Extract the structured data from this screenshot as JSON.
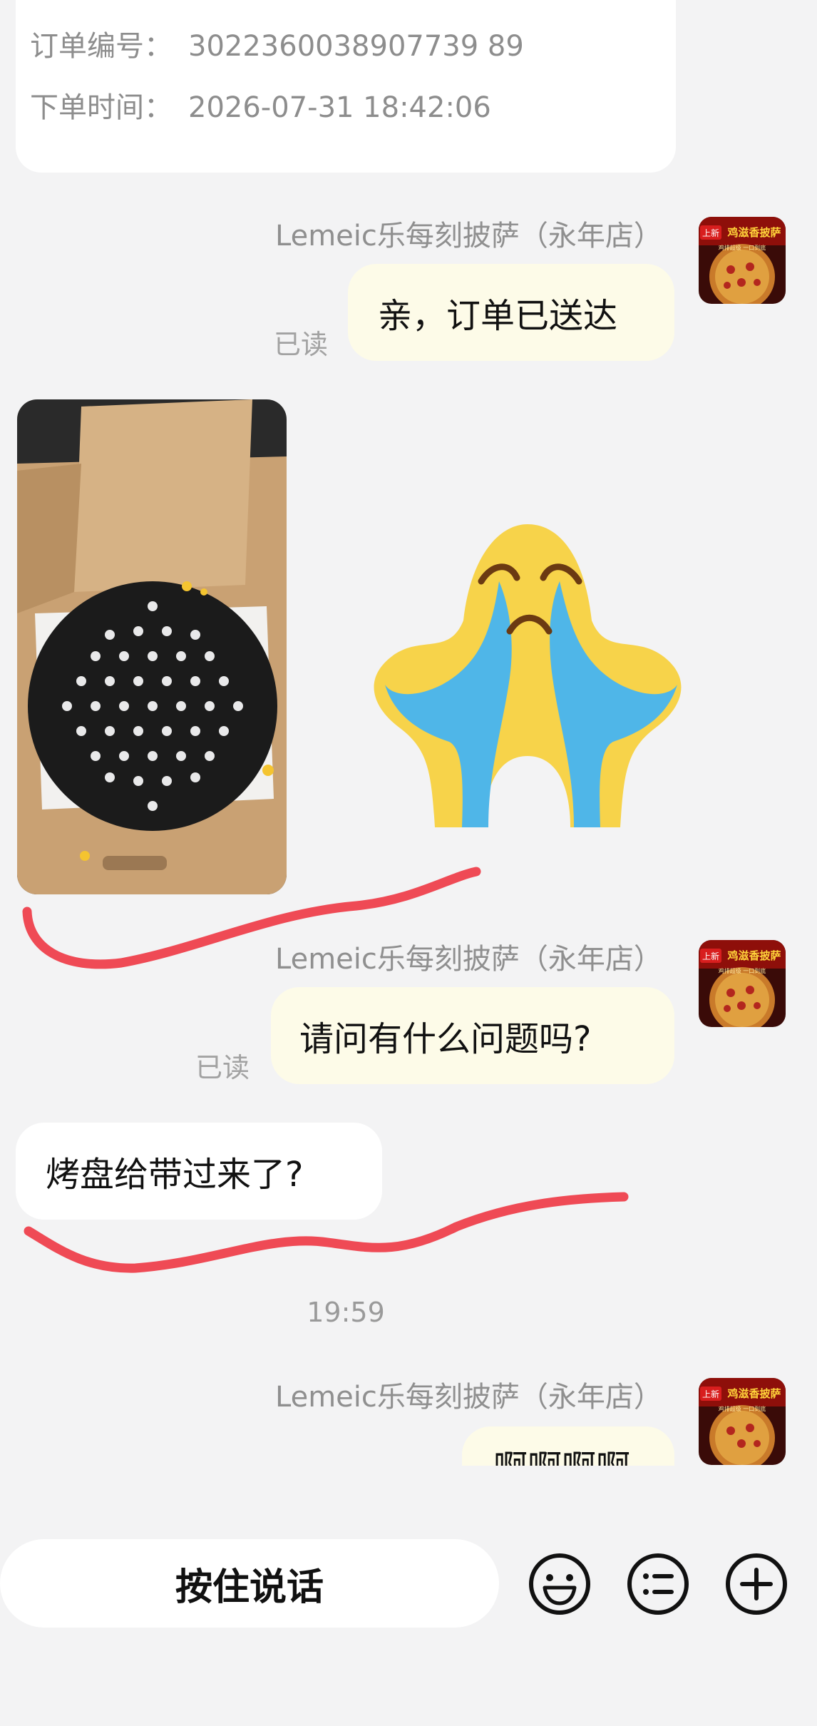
{
  "order": {
    "number_label": "订单编号：",
    "number_value": "3022360038907739 89",
    "time_label": "下单时间：",
    "time_value": "2026-07-31 18:42:06"
  },
  "messages": {
    "m1": {
      "sender": "Lemeic乐每刻披萨（永年店）",
      "text": "亲，订单已送达",
      "read": "已读"
    },
    "m2": {
      "sender": "Lemeic乐每刻披萨（永年店）",
      "text": "请问有什么问题吗?",
      "read": "已读"
    },
    "m3": {
      "text": "烤盘给带过来了?"
    },
    "time_divider": "19:59",
    "m4": {
      "sender": "Lemeic乐每刻披萨（永年店）",
      "text": "啊啊啊啊"
    }
  },
  "avatar": {
    "badge": "上新",
    "title": "鸡滋香披萨",
    "sub": "鸡排超级 一口到底"
  },
  "input_bar": {
    "voice_label": "按住说话",
    "icons": [
      "emoji-icon",
      "quick-reply-icon",
      "plus-icon"
    ]
  },
  "colors": {
    "outgoing_bubble": "#fdfbe8",
    "incoming_bubble": "#ffffff",
    "scribble": "#ef4a55",
    "background": "#f3f3f4"
  }
}
